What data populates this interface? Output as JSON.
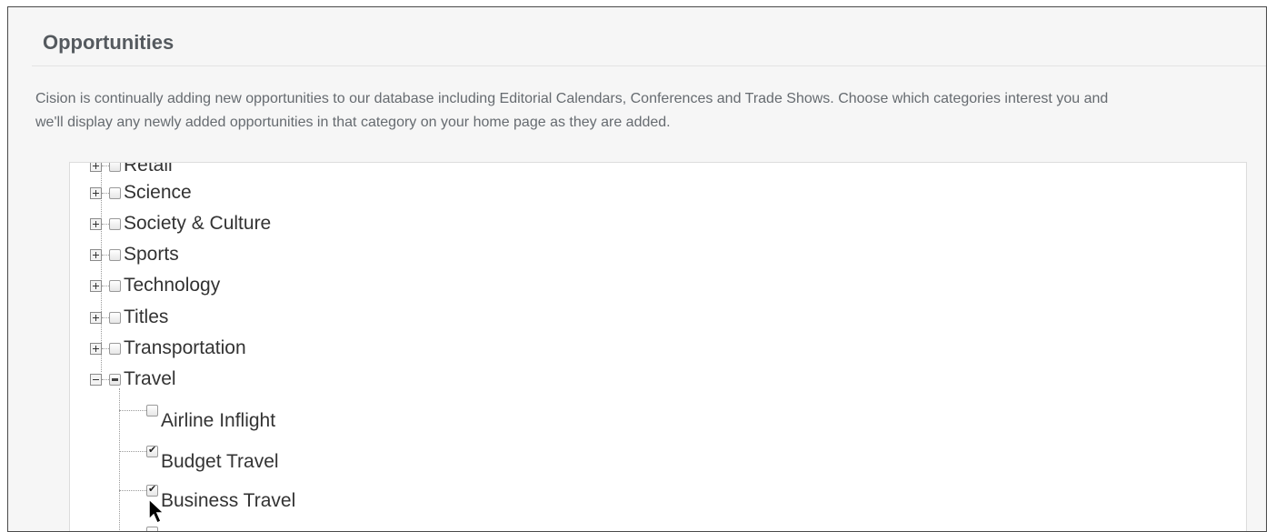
{
  "section": {
    "title": "Opportunities",
    "description": "Cision is continually adding new opportunities to our database including Editorial Calendars, Conferences and Trade Shows. Choose which categories interest you and we'll display any newly added opportunities in that category on your home page as they are added."
  },
  "tree": {
    "categories": [
      {
        "label": "Retail",
        "expanded": false,
        "state": "unchecked"
      },
      {
        "label": "Science",
        "expanded": false,
        "state": "unchecked"
      },
      {
        "label": "Society & Culture",
        "expanded": false,
        "state": "unchecked"
      },
      {
        "label": "Sports",
        "expanded": false,
        "state": "unchecked"
      },
      {
        "label": "Technology",
        "expanded": false,
        "state": "unchecked"
      },
      {
        "label": "Titles",
        "expanded": false,
        "state": "unchecked"
      },
      {
        "label": "Transportation",
        "expanded": false,
        "state": "unchecked"
      },
      {
        "label": "Travel",
        "expanded": true,
        "state": "partial"
      }
    ],
    "travel_children": [
      {
        "label": "Airline Inflight",
        "state": "unchecked"
      },
      {
        "label": "Budget Travel",
        "state": "checked"
      },
      {
        "label": "Business Travel",
        "state": "checked"
      }
    ]
  },
  "icons": {
    "expand": "plus-icon",
    "collapse": "minus-icon",
    "cursor": "mouse-pointer-icon"
  }
}
